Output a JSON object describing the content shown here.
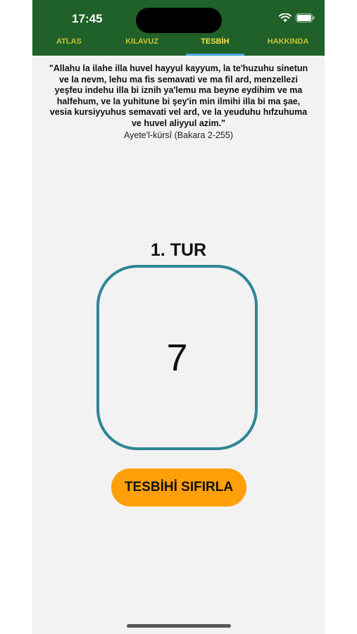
{
  "status_bar": {
    "time": "17:45",
    "icons": [
      "wifi-icon",
      "battery-icon"
    ]
  },
  "tabs": [
    {
      "label": "ATLAS",
      "active": false
    },
    {
      "label": "KILAVUZ",
      "active": false
    },
    {
      "label": "TESBİH",
      "active": true
    },
    {
      "label": "HAKKINDA",
      "active": false
    }
  ],
  "verse": {
    "text": "\"Allahu la ilahe illa huvel hayyul kayyum, la te'huzuhu sinetun ve la nevm, lehu ma fis semavati ve ma fil ard, menzellezi yeşfeu indehu illa bi iznih ya'lemu ma beyne eydihim ve ma halfehum, ve la yuhitune bi şey'in min ilmihi illa bi ma şae, vesia kursiyyuhus semavati vel ard, ve la yeuduhu hıfzuhuma ve huvel aliyyul azim.\"",
    "reference": "Ayete'l-kürsî (Bakara 2-255)"
  },
  "counter": {
    "round_label": "1. TUR",
    "value": "7"
  },
  "reset_button": {
    "label": "TESBİHİ SIFIRLA"
  },
  "colors": {
    "appbar": "#1f6128",
    "tab_text": "#c8c23a",
    "active_indicator": "#4aa3df",
    "counter_border": "#2e8595",
    "reset_button": "#ff9f0a",
    "background": "#f2f2f2"
  }
}
